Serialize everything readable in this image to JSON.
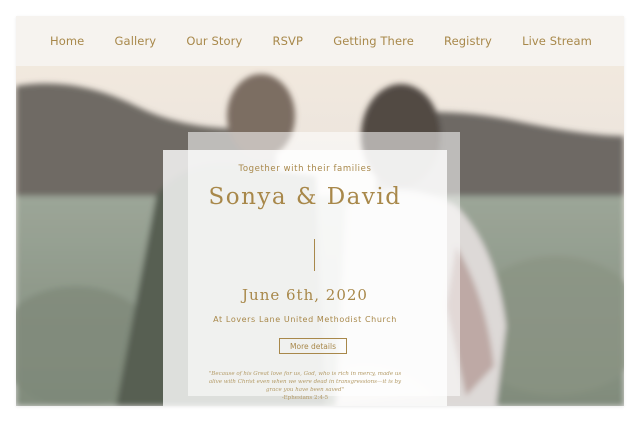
{
  "nav": {
    "items": [
      {
        "label": "Home"
      },
      {
        "label": "Gallery"
      },
      {
        "label": "Our Story"
      },
      {
        "label": "RSVP"
      },
      {
        "label": "Getting There"
      },
      {
        "label": "Registry"
      },
      {
        "label": "Live Stream"
      }
    ]
  },
  "hero": {
    "subtitle": "Together with their families",
    "names": "Sonya & David",
    "date": "June 6th, 2020",
    "venue": "At Lovers Lane United Methodist Church",
    "details_button": "More details",
    "verse": "\"Because of his Great love for us, God, who is rich in mercy, made us alive with Christ even when we were dead in transgressions—it is by grace you have been saved\"",
    "verse_ref": "-Ephesians 2:4-5"
  },
  "colors": {
    "accent": "#a8884a",
    "nav_background": "#f7f4f0"
  }
}
